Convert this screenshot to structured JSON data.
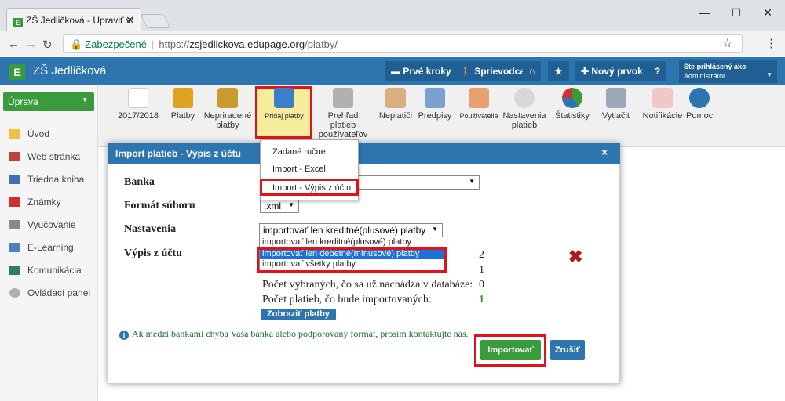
{
  "browser": {
    "tab_title": "ZŠ Jedličková - Upraviť v:",
    "tab_close": "✕",
    "secure_label": "Zabezpečené",
    "url_scheme": "https://",
    "url_domain": "zsjedlickova.edupage.org",
    "url_path": "/platby/",
    "min": "—",
    "max": "☐",
    "close": "✕"
  },
  "app": {
    "logo_letter": "E",
    "school_name": "ZŠ Jedličková",
    "header_buttons": [
      "Prvé kroky",
      "Sprievodca",
      "⌂",
      "★",
      "Nový prvok",
      "?"
    ],
    "user_line1": "Ste prihlásený ako",
    "user_line2": "Administrátor"
  },
  "toolbar": {
    "year": "2017/2018",
    "items": [
      "Platby",
      "Nepriradené platby",
      "Pridaj platby",
      "Prehľad platieb používateľov",
      "Neplatiči",
      "Predpisy",
      "Používatelia",
      "Nastavenia platieb",
      "Štatistiky",
      "Vytlačiť",
      "Notifikácie",
      "Pomoc"
    ]
  },
  "sidebar": {
    "section": "Úprava",
    "items": [
      "Úvod",
      "Web stránka",
      "Triedna kniha",
      "Známky",
      "Vyučovanie",
      "E-Learning",
      "Komunikácia",
      "Ovládací panel"
    ]
  },
  "dropdown_menu": {
    "items": [
      "Zadané ručne",
      "Import - Excel",
      "Import - Výpis z účtu"
    ]
  },
  "dialog": {
    "title": "Import platieb - Výpis z účtu",
    "close": "×",
    "labels": {
      "bank": "Banka",
      "format": "Formát súboru",
      "settings": "Nastavenia",
      "statement": "Výpis z účtu"
    },
    "format_value": ".xml",
    "settings_value": "importovať len kreditné(plusové) platby",
    "settings_options": [
      "importovať len kreditné(plusové) platby",
      "importovať len debetné(mínusové) platby",
      "importovať všetky platby"
    ],
    "stats": {
      "val1": "2",
      "val2": "1",
      "row_db_label": "Počet vybraných, čo sa už nachádza v databáze:",
      "row_db_value": "0",
      "row_imp_label": "Počet platieb, čo bude importovaných:",
      "row_imp_value": "1"
    },
    "show_button": "Zobraziť platby",
    "info_text": "Ak medzi bankami chýba Vaša banka alebo podporovaný formát, prosím kontaktujte nás.",
    "import_button": "Importovať",
    "cancel_button": "Zrušiť"
  }
}
